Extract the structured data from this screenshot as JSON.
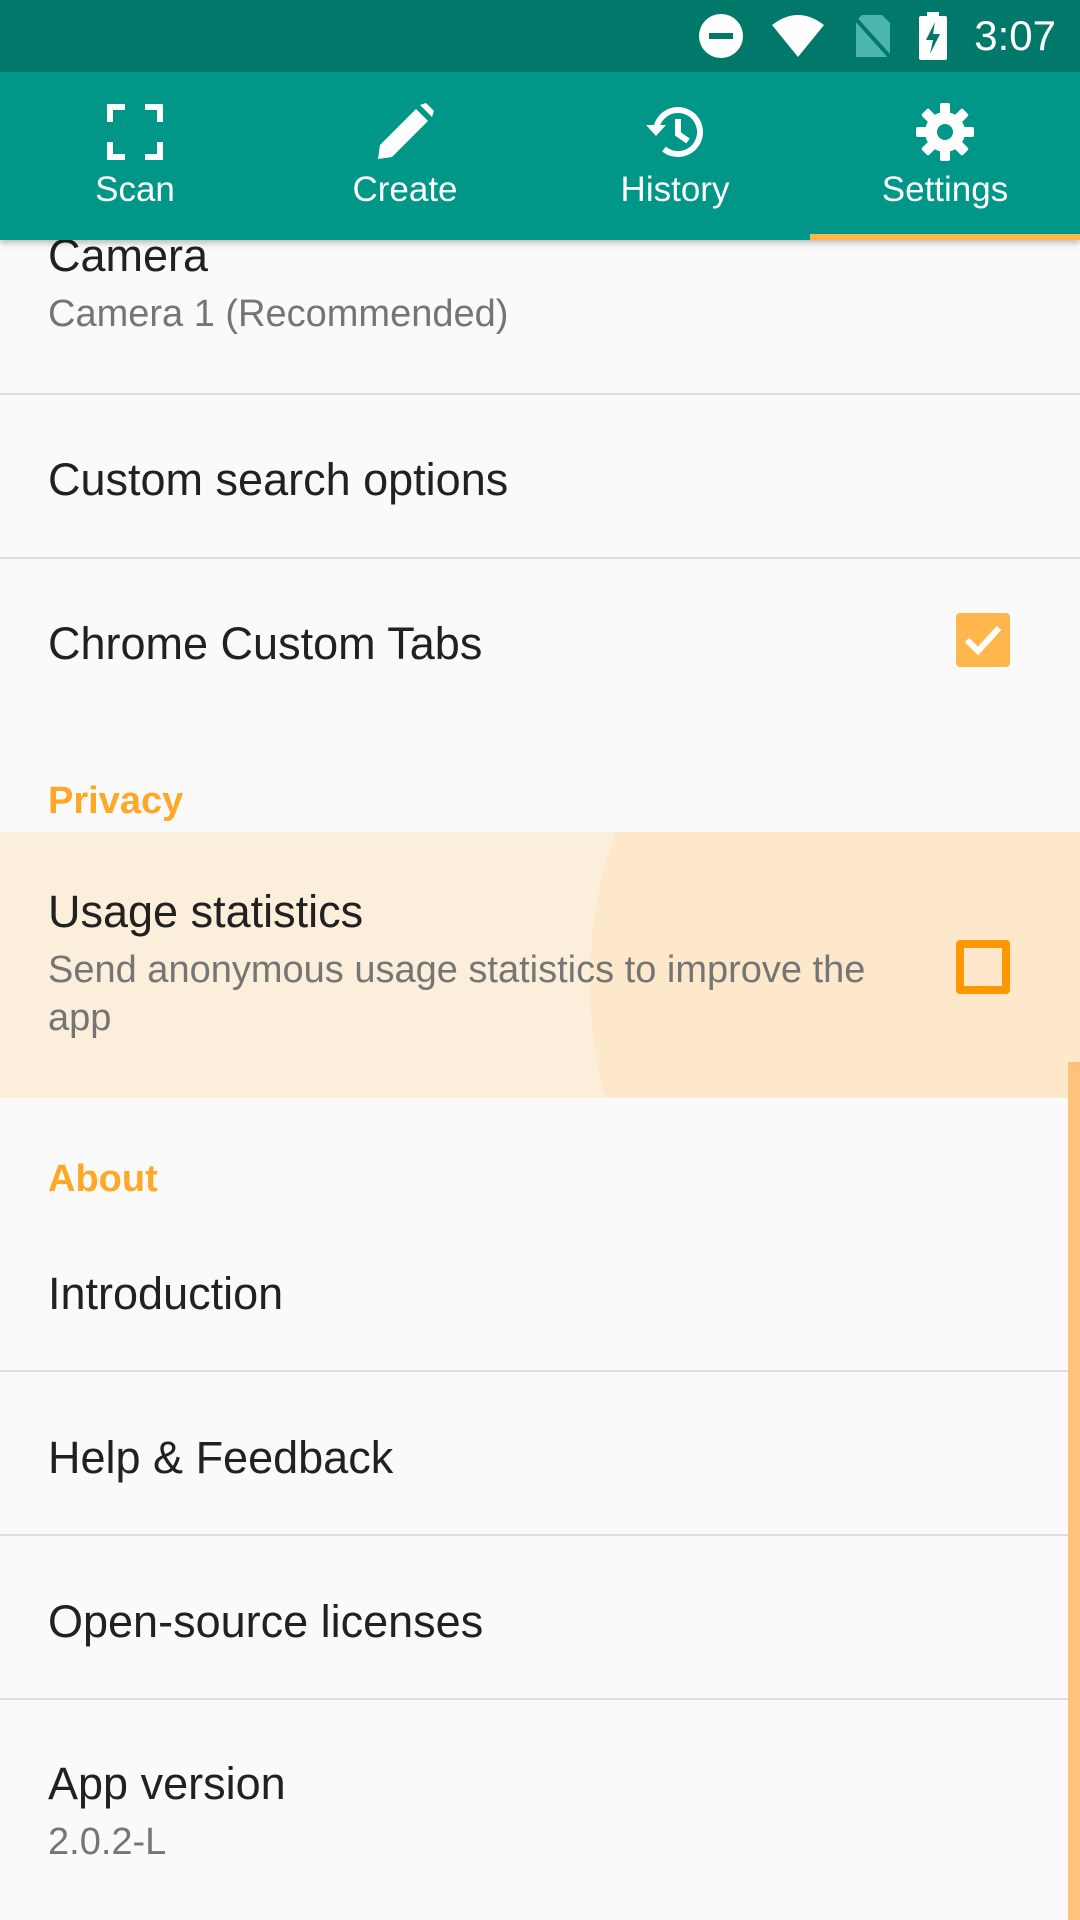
{
  "status_bar": {
    "time": "3:07",
    "icons": [
      "do-not-disturb-icon",
      "wifi-icon",
      "no-sim-icon",
      "battery-charging-icon"
    ]
  },
  "tabs": [
    {
      "label": "Scan",
      "icon": "scan-icon",
      "active": false
    },
    {
      "label": "Create",
      "icon": "pencil-icon",
      "active": false
    },
    {
      "label": "History",
      "icon": "history-icon",
      "active": false
    },
    {
      "label": "Settings",
      "icon": "gear-icon",
      "active": true
    }
  ],
  "settings": {
    "camera": {
      "title": "Camera",
      "summary": "Camera 1 (Recommended)"
    },
    "custom_search": {
      "title": "Custom search options"
    },
    "chrome_tabs": {
      "title": "Chrome Custom Tabs",
      "checked": true
    },
    "privacy_header": "Privacy",
    "usage_stats": {
      "title": "Usage statistics",
      "summary": "Send anonymous usage statistics to improve the app",
      "checked": false
    },
    "about_header": "About",
    "introduction": {
      "title": "Introduction"
    },
    "help": {
      "title": "Help & Feedback"
    },
    "licenses": {
      "title": "Open-source licenses"
    },
    "version": {
      "title": "App version",
      "summary": "2.0.2-L"
    }
  },
  "colors": {
    "primary": "#009688",
    "primary_dark": "#00796b",
    "accent": "#ffa726"
  }
}
